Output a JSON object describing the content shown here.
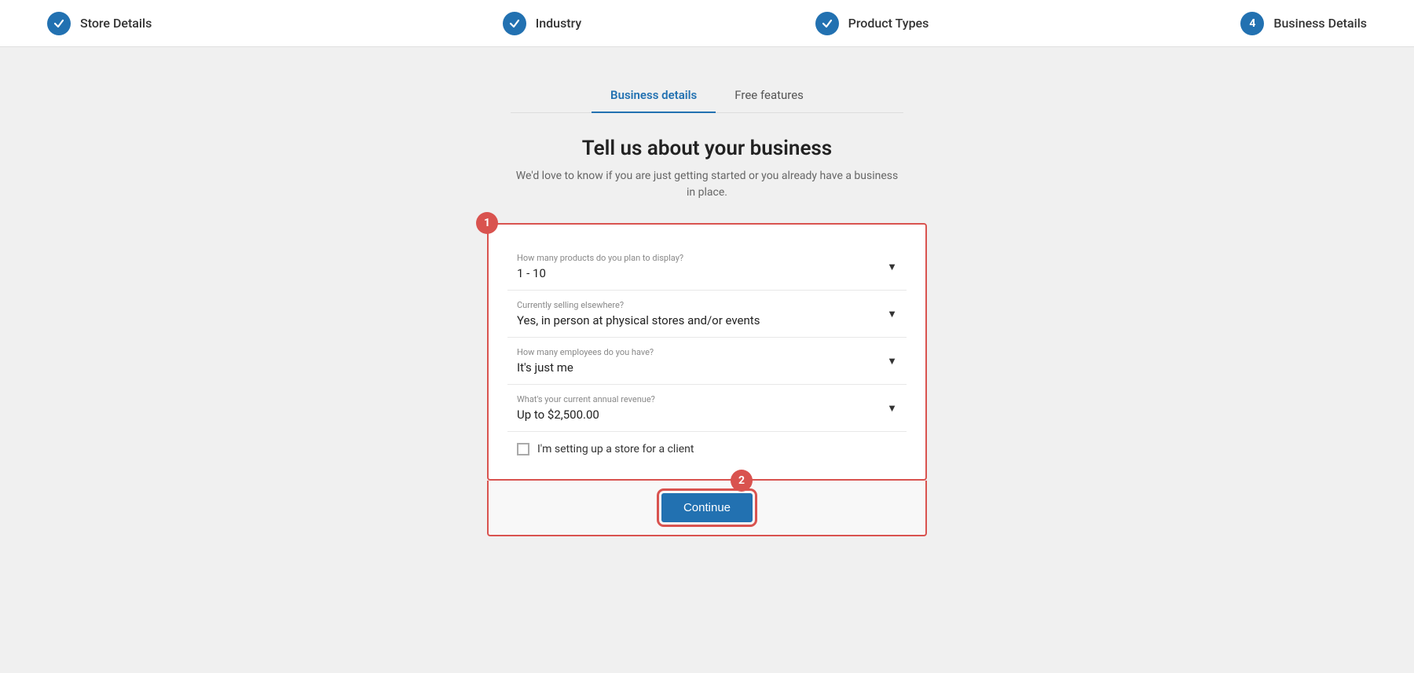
{
  "stepper": {
    "steps": [
      {
        "id": "store-details",
        "label": "Store Details",
        "type": "check"
      },
      {
        "id": "industry",
        "label": "Industry",
        "type": "check"
      },
      {
        "id": "product-types",
        "label": "Product Types",
        "type": "check"
      },
      {
        "id": "business-details",
        "label": "Business Details",
        "type": "number",
        "number": "4"
      }
    ]
  },
  "tabs": [
    {
      "id": "business-details",
      "label": "Business details",
      "active": true
    },
    {
      "id": "free-features",
      "label": "Free features",
      "active": false
    }
  ],
  "page": {
    "title": "Tell us about your business",
    "subtitle": "We'd love to know if you are just getting started or you already have a business in place."
  },
  "form": {
    "step_badge": "1",
    "fields": [
      {
        "id": "products-count",
        "label": "How many products do you plan to display?",
        "value": "1 - 10"
      },
      {
        "id": "selling-elsewhere",
        "label": "Currently selling elsewhere?",
        "value": "Yes, in person at physical stores and/or events"
      },
      {
        "id": "employees",
        "label": "How many employees do you have?",
        "value": "It's just me"
      },
      {
        "id": "annual-revenue",
        "label": "What's your current annual revenue?",
        "value": "Up to $2,500.00"
      }
    ],
    "checkbox": {
      "label": "I'm setting up a store for a client",
      "checked": false
    }
  },
  "continue_section": {
    "step_badge": "2",
    "button_label": "Continue"
  }
}
